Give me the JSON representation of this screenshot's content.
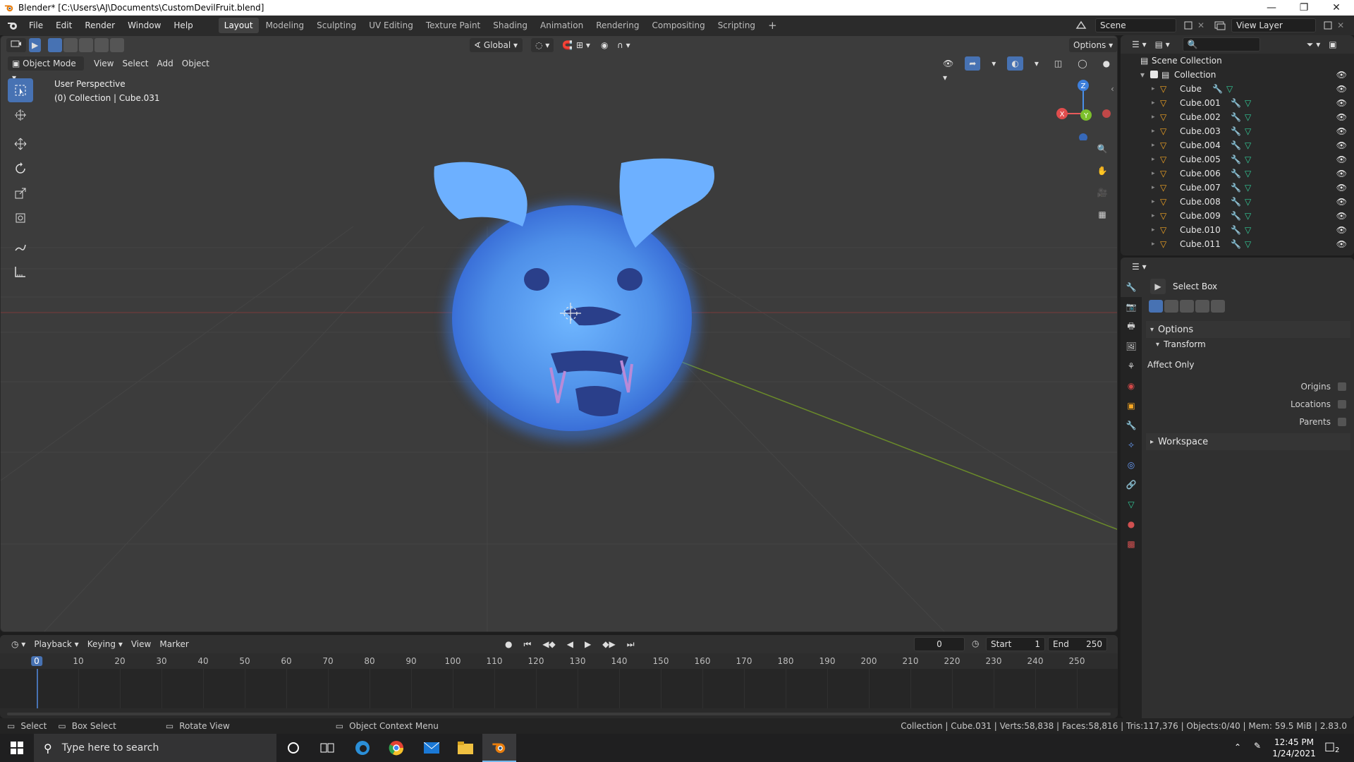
{
  "title_bar": {
    "title": "Blender* [C:\\Users\\AJ\\Documents\\CustomDevilFruit.blend]"
  },
  "menu": [
    "File",
    "Edit",
    "Render",
    "Window",
    "Help"
  ],
  "workspaces": [
    "Layout",
    "Modeling",
    "Sculpting",
    "UV Editing",
    "Texture Paint",
    "Shading",
    "Animation",
    "Rendering",
    "Compositing",
    "Scripting"
  ],
  "active_workspace": "Layout",
  "scene": {
    "scene_name": "Scene",
    "view_layer": "View Layer"
  },
  "viewport": {
    "mode": "Object Mode",
    "header_menus": [
      "View",
      "Select",
      "Add",
      "Object"
    ],
    "orientation": "Global",
    "options_label": "Options",
    "info_line1": "User Perspective",
    "info_line2": "(0) Collection | Cube.031"
  },
  "gizmo": {
    "z": "Z",
    "y": "Y",
    "x": "X"
  },
  "outliner": {
    "root": "Scene Collection",
    "collection": "Collection",
    "objects": [
      "Cube",
      "Cube.001",
      "Cube.002",
      "Cube.003",
      "Cube.004",
      "Cube.005",
      "Cube.006",
      "Cube.007",
      "Cube.008",
      "Cube.009",
      "Cube.010",
      "Cube.011"
    ]
  },
  "properties": {
    "tool_name": "Select Box",
    "options_panel": "Options",
    "transform_panel": "Transform",
    "affect_only": "Affect Only",
    "checkboxes": [
      {
        "label": "Origins",
        "checked": false
      },
      {
        "label": "Locations",
        "checked": false
      },
      {
        "label": "Parents",
        "checked": false
      }
    ],
    "workspace_panel": "Workspace"
  },
  "timeline": {
    "menus": [
      "Playback",
      "Keying",
      "View",
      "Marker"
    ],
    "current_frame": "0",
    "start_label": "Start",
    "start_value": "1",
    "end_label": "End",
    "end_value": "250",
    "ruler": [
      "0",
      "10",
      "20",
      "30",
      "40",
      "50",
      "60",
      "70",
      "80",
      "90",
      "100",
      "110",
      "120",
      "130",
      "140",
      "150",
      "160",
      "170",
      "180",
      "190",
      "200",
      "210",
      "220",
      "230",
      "240",
      "250"
    ]
  },
  "statusbar": {
    "select": "Select",
    "box_select": "Box Select",
    "rotate_view": "Rotate View",
    "context_menu": "Object Context Menu",
    "stats": "Collection | Cube.031 | Verts:58,838 | Faces:58,816 | Tris:117,376 | Objects:0/40 | Mem: 59.5 MiB | 2.83.0"
  },
  "taskbar": {
    "search_placeholder": "Type here to search",
    "time": "12:45 PM",
    "date": "1/24/2021",
    "notification_count": "2"
  },
  "colors": {
    "accent": "#4772b3",
    "object_orange": "#f5a623",
    "mesh_green": "#33cc99",
    "glow_blue": "#5aa0ff"
  }
}
